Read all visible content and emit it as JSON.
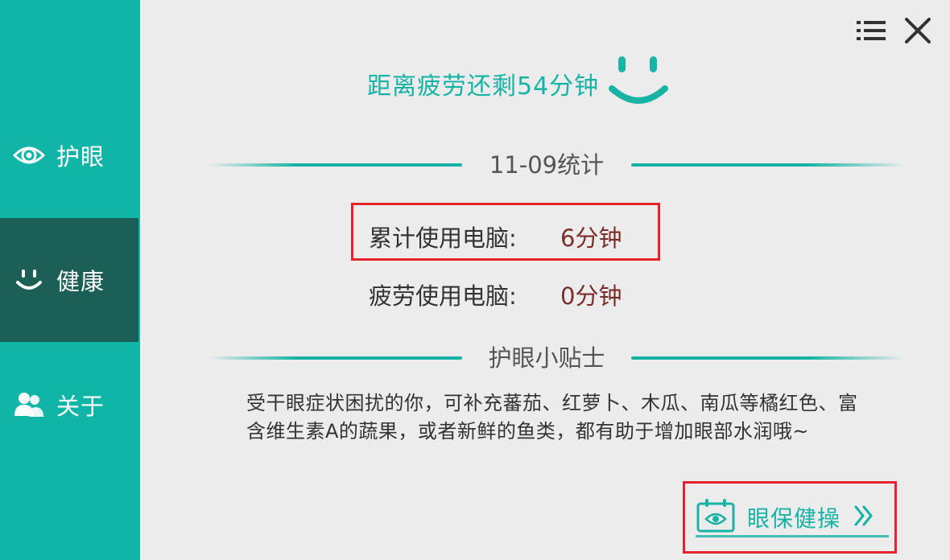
{
  "sidebar": {
    "items": [
      {
        "label": "护眼",
        "icon": "eye-icon"
      },
      {
        "label": "健康",
        "icon": "smile-icon",
        "active": true
      },
      {
        "label": "关于",
        "icon": "users-icon"
      }
    ]
  },
  "header": {
    "menu_icon": "menu-icon",
    "close_icon": "close-icon"
  },
  "status": {
    "text": "距离疲劳还剩54分钟",
    "icon": "smiley-face-icon"
  },
  "stats": {
    "title": "11-09统计",
    "rows": [
      {
        "label": "累计使用电脑:",
        "value": "6分钟"
      },
      {
        "label": "疲劳使用电脑:",
        "value": "0分钟"
      }
    ]
  },
  "tips": {
    "title": "护眼小贴士",
    "text": "受干眼症状困扰的你，可补充蕃茄、红萝卜、木瓜、南瓜等橘红色、富含维生素A的蔬果，或者新鲜的鱼类，都有助于增加眼部水润哦~"
  },
  "exercise": {
    "label": "眼保健操",
    "icon": "calendar-eye-icon",
    "arrow_icon": "double-chevron-right-icon"
  },
  "colors": {
    "accent": "#17b4a6",
    "sidebar": "#10b5a7",
    "sidebar_active": "#1c5f56",
    "value": "#7a2e2a",
    "highlight": "#e5232a"
  }
}
